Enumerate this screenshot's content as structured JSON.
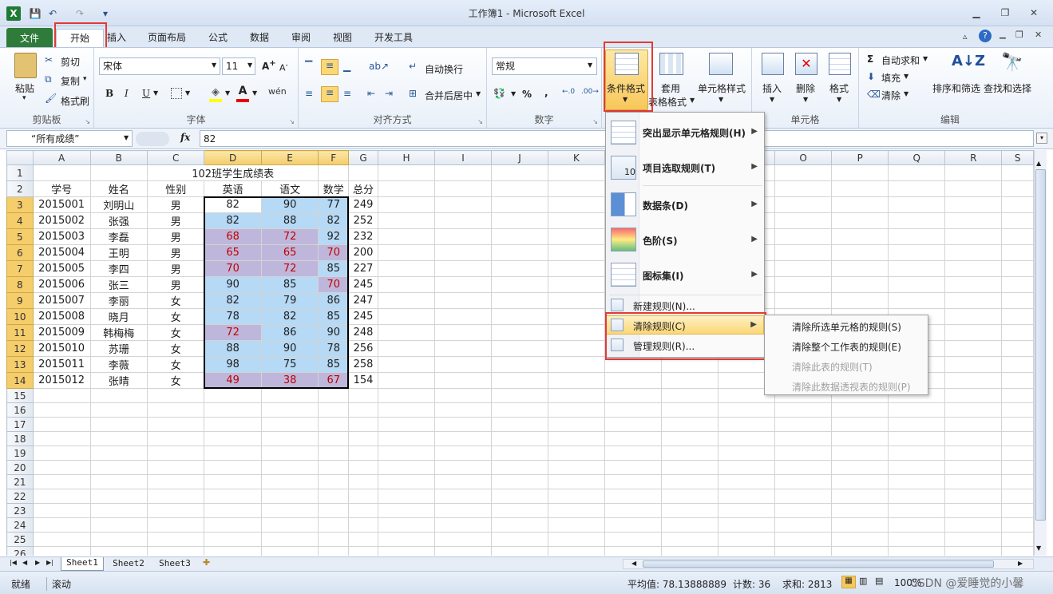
{
  "window": {
    "title": "工作簿1 - Microsoft Excel"
  },
  "tabs": [
    "文件",
    "开始",
    "插入",
    "页面布局",
    "公式",
    "数据",
    "审阅",
    "视图",
    "开发工具"
  ],
  "ribbon": {
    "clipboard": {
      "paste": "粘贴",
      "cut": "剪切",
      "copy": "复制",
      "format_painter": "格式刷",
      "group": "剪贴板"
    },
    "font": {
      "name": "宋体",
      "size": "11",
      "bold": "B",
      "italic": "I",
      "underline": "U",
      "group": "字体"
    },
    "align": {
      "wrap": "自动换行",
      "merge": "合并后居中",
      "group": "对齐方式"
    },
    "number": {
      "format": "常规",
      "percent": "%",
      "comma": ",",
      "group": "数字"
    },
    "styles": {
      "conditional": "条件格式",
      "table_a": "套用",
      "table_b": "表格格式",
      "cell_styles": "单元格样式"
    },
    "cells": {
      "insert": "插入",
      "delete": "删除",
      "format": "格式",
      "group": "单元格"
    },
    "editing": {
      "autosum": "自动求和",
      "fill": "填充",
      "clear": "清除",
      "sort": "排序和筛选",
      "find": "查找和选择",
      "group": "编辑"
    }
  },
  "formula": {
    "name_box": "“所有成绩”",
    "fx": "fx",
    "value": "82"
  },
  "columns": [
    "A",
    "B",
    "C",
    "D",
    "E",
    "F",
    "G",
    "H",
    "I",
    "J",
    "K",
    "L",
    "M",
    "N",
    "O",
    "P",
    "Q",
    "R",
    "S"
  ],
  "sheet": {
    "title": "102班学生成绩表",
    "headers": [
      "学号",
      "姓名",
      "性别",
      "英语",
      "语文",
      "数学",
      "总分"
    ],
    "rows": [
      [
        "2015001",
        "刘明山",
        "男",
        "82",
        "90",
        "77",
        "249"
      ],
      [
        "2015002",
        "张强",
        "男",
        "82",
        "88",
        "82",
        "252"
      ],
      [
        "2015003",
        "李磊",
        "男",
        "68",
        "72",
        "92",
        "232"
      ],
      [
        "2015004",
        "王明",
        "男",
        "65",
        "65",
        "70",
        "200"
      ],
      [
        "2015005",
        "李四",
        "男",
        "70",
        "72",
        "85",
        "227"
      ],
      [
        "2015006",
        "张三",
        "男",
        "90",
        "85",
        "70",
        "245"
      ],
      [
        "2015007",
        "李丽",
        "女",
        "82",
        "79",
        "86",
        "247"
      ],
      [
        "2015008",
        "晓月",
        "女",
        "78",
        "82",
        "85",
        "245"
      ],
      [
        "2015009",
        "韩梅梅",
        "女",
        "72",
        "86",
        "90",
        "248"
      ],
      [
        "2015010",
        "苏珊",
        "女",
        "88",
        "90",
        "78",
        "256"
      ],
      [
        "2015011",
        "李薇",
        "女",
        "98",
        "75",
        "85",
        "258"
      ],
      [
        "2015012",
        "张晴",
        "女",
        "49",
        "38",
        "67",
        "154"
      ]
    ]
  },
  "cf_menu": {
    "items": [
      {
        "label": "突出显示单元格规则(H)",
        "icon": "highlight-rules-icon"
      },
      {
        "label": "项目选取规则(T)",
        "icon": "top-bottom-rules-icon"
      },
      {
        "label": "数据条(D)",
        "icon": "data-bars-icon"
      },
      {
        "label": "色阶(S)",
        "icon": "color-scales-icon"
      },
      {
        "label": "图标集(I)",
        "icon": "icon-sets-icon"
      }
    ],
    "new_rule": "新建规则(N)...",
    "clear_rules": "清除规则(C)",
    "manage_rules": "管理规则(R)..."
  },
  "clear_submenu": [
    "清除所选单元格的规则(S)",
    "清除整个工作表的规则(E)",
    "清除此表的规则(T)",
    "清除此数据透视表的规则(P)"
  ],
  "sheet_tabs": [
    "Sheet1",
    "Sheet2",
    "Sheet3"
  ],
  "status": {
    "ready": "就绪",
    "scroll": "滚动",
    "average": "平均值: 78.13888889",
    "count": "计数: 36",
    "sum": "求和: 2813",
    "zoom": "100%",
    "watermark": "CSDN @爱睡觉的小馨"
  }
}
